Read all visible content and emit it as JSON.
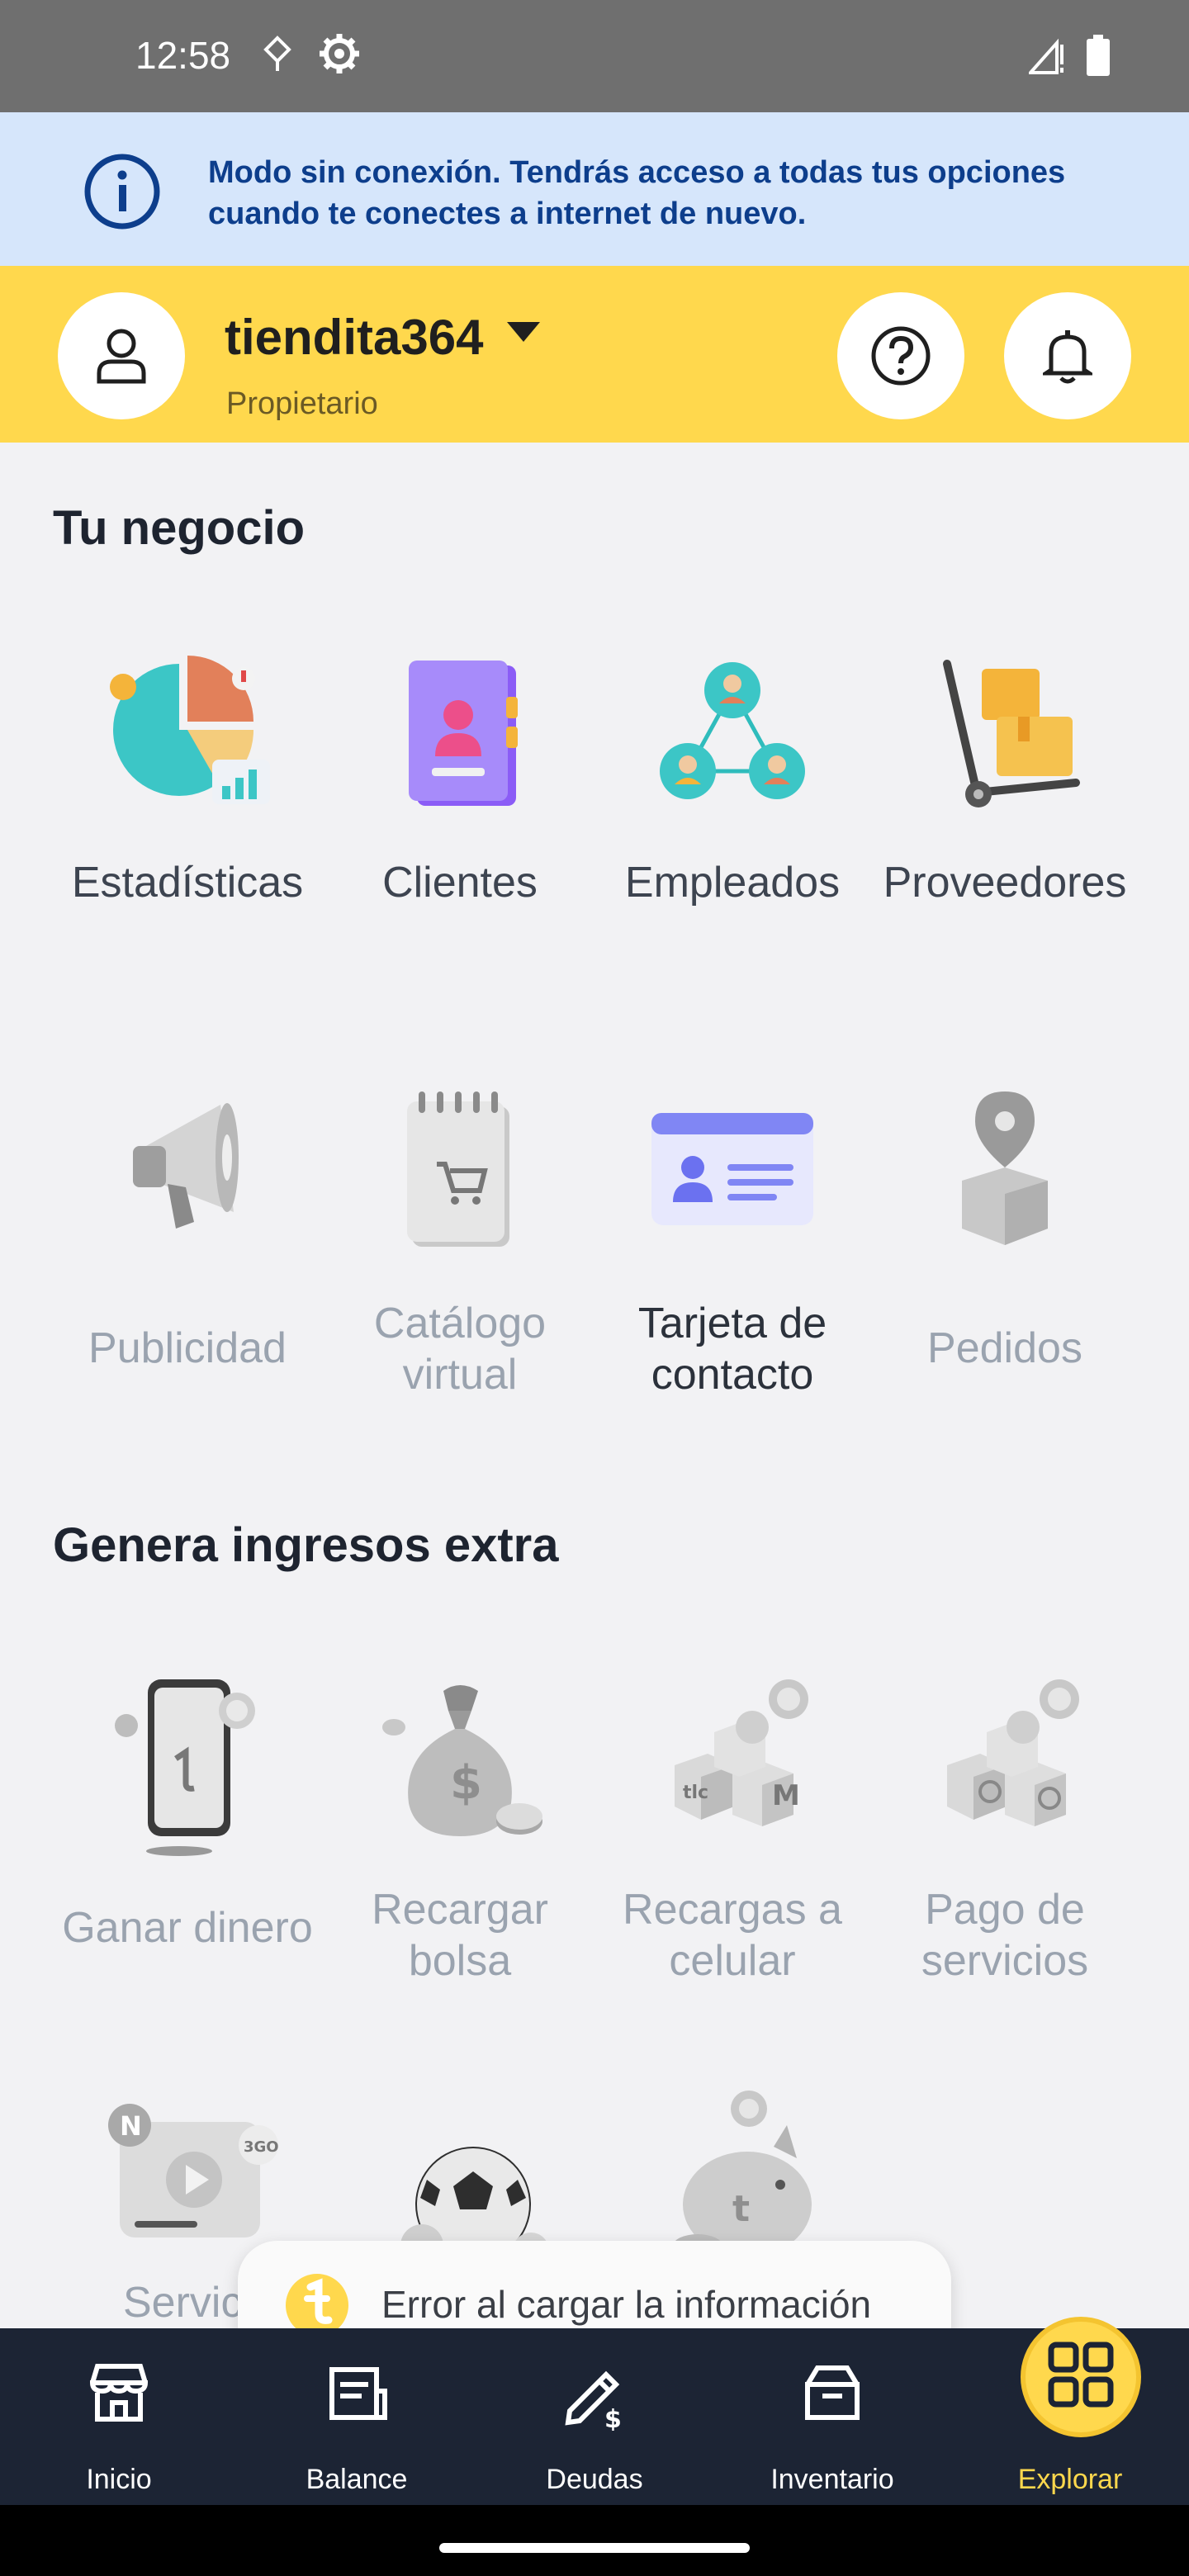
{
  "status_bar": {
    "time": "12:58"
  },
  "offline_banner": {
    "message": "Modo sin conexión. Tendrás acceso a todas tus opciones cuando te conectes a internet de nuevo."
  },
  "header": {
    "store_name": "tiendita364",
    "role": "Propietario"
  },
  "section_business": {
    "title": "Tu negocio",
    "items": [
      {
        "label": "Estadísticas"
      },
      {
        "label": "Clientes"
      },
      {
        "label": "Empleados"
      },
      {
        "label": "Proveedores"
      },
      {
        "label": "Publicidad"
      },
      {
        "label": "Catálogo virtual"
      },
      {
        "label": "Tarjeta de contacto"
      },
      {
        "label": "Pedidos"
      }
    ]
  },
  "section_income": {
    "title": "Genera ingresos extra",
    "items": [
      {
        "label": "Ganar dinero"
      },
      {
        "label": "Recargar bolsa"
      },
      {
        "label": "Recargas a celular"
      },
      {
        "label": "Pago de servicios"
      },
      {
        "label": "Servici"
      }
    ]
  },
  "toast": {
    "message": "Error al cargar la información"
  },
  "bottom_nav": {
    "items": [
      {
        "label": "Inicio"
      },
      {
        "label": "Balance"
      },
      {
        "label": "Deudas"
      },
      {
        "label": "Inventario"
      },
      {
        "label": "Explorar"
      }
    ]
  },
  "colors": {
    "brand_yellow": "#ffd84d",
    "nav_background": "#1c2434",
    "banner_background": "#d6e6fb",
    "banner_text": "#0d3e8c"
  }
}
